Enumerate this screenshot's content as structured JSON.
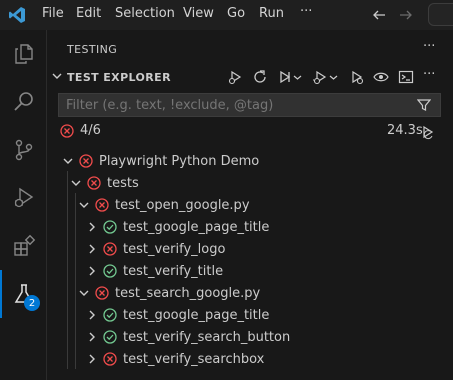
{
  "menu": [
    "File",
    "Edit",
    "Selection",
    "View",
    "Go",
    "Run",
    "···"
  ],
  "sidebar": {
    "title": "TESTING",
    "more": "···",
    "section_title": "TEST EXPLORER",
    "filter_placeholder": "Filter (e.g. text, !exclude, @tag)",
    "summary_count": "4/6",
    "duration": "24.3s"
  },
  "activity": {
    "testing_badge": "2"
  },
  "tree": [
    {
      "label": "Playwright Python Demo",
      "status": "failed",
      "level": 0,
      "expanded": true
    },
    {
      "label": "tests",
      "status": "failed",
      "level": 1,
      "expanded": true
    },
    {
      "label": "test_open_google.py",
      "status": "failed",
      "level": 2,
      "expanded": true
    },
    {
      "label": "test_google_page_title",
      "status": "passed",
      "level": 3,
      "expanded": false
    },
    {
      "label": "test_verify_logo",
      "status": "failed",
      "level": 3,
      "expanded": false
    },
    {
      "label": "test_verify_title",
      "status": "passed",
      "level": 3,
      "expanded": false
    },
    {
      "label": "test_search_google.py",
      "status": "failed",
      "level": 2,
      "expanded": true
    },
    {
      "label": "test_google_page_title",
      "status": "passed",
      "level": 3,
      "expanded": false
    },
    {
      "label": "test_verify_search_button",
      "status": "passed",
      "level": 3,
      "expanded": false
    },
    {
      "label": "test_verify_searchbox",
      "status": "failed",
      "level": 3,
      "expanded": false
    }
  ],
  "colors": {
    "passed": "#73c991",
    "failed": "#f14c4c",
    "accent": "#0078d4",
    "vscode_logo": "#3c99d4"
  }
}
